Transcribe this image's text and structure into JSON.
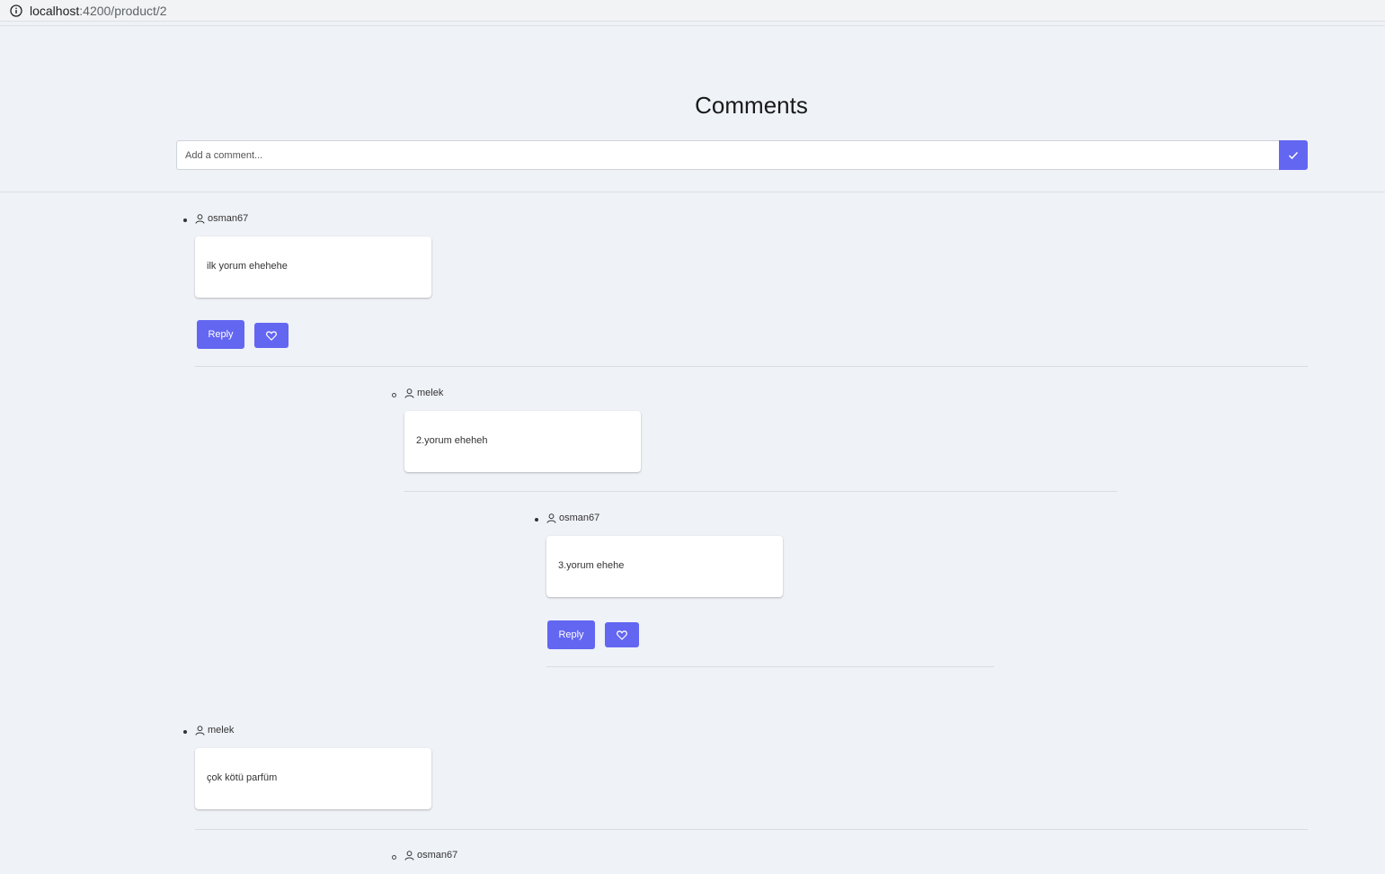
{
  "browser": {
    "url_host": "localhost",
    "url_path": ":4200/product/2"
  },
  "page": {
    "title": "Comments"
  },
  "form": {
    "placeholder": "Add a comment..."
  },
  "buttons": {
    "reply_label": "Reply"
  },
  "comments": [
    {
      "author": "osman67",
      "text": "ilk yorum ehehehe"
    },
    {
      "author": "melek",
      "text": "2.yorum eheheh"
    },
    {
      "author": "osman67",
      "text": "3.yorum ehehe"
    },
    {
      "author": "melek",
      "text": "çok kötü parfüm"
    },
    {
      "author": "osman67"
    }
  ],
  "colors": {
    "accent": "#6366f1",
    "background": "#eff2f7",
    "card": "#ffffff"
  }
}
